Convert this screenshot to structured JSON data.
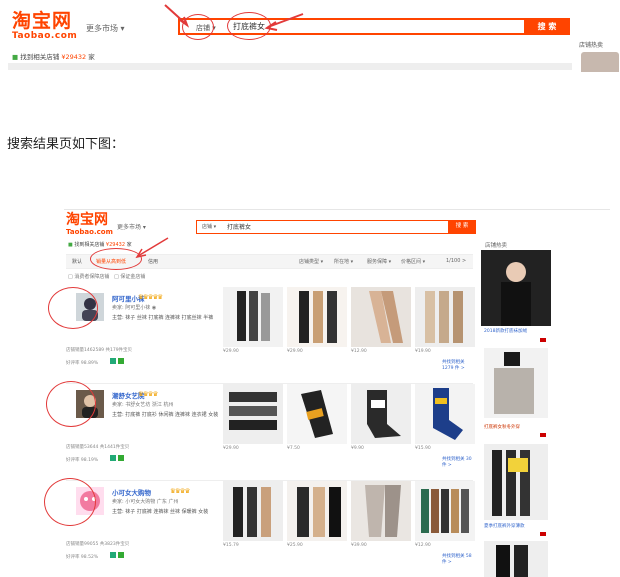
{
  "top_screenshot": {
    "logo_cn": "淘宝网",
    "logo_en": "Taobao.com",
    "market_label": "更多市场 ▾",
    "search_scope": "店铺 ▾",
    "search_query": "打底裤女",
    "search_button": "搜 索",
    "found_text": "找到相关店铺 ",
    "found_count": "¥29432",
    "found_unit": " 家",
    "side_label": "店铺热卖"
  },
  "caption": "搜索结果页如下图：",
  "results_screenshot": {
    "logo_cn": "淘宝网",
    "logo_en": "Taobao.com",
    "market_label": "更多市场 ▾",
    "search_scope": "店铺 ▾",
    "search_query": "打底裤女",
    "search_button": "搜 索",
    "found_text": "找到相关店铺 ",
    "found_count": "¥29432",
    "found_unit": " 家",
    "tabs": [
      "默认",
      "销量从高到低",
      "信用"
    ],
    "filters": [
      "店铺类型 ▾",
      "所在地 ▾",
      "服务保障 ▾",
      "价格区间 ▾",
      "1/100 >"
    ],
    "checks": [
      "□ 消费者保障店铺",
      "□ 保证金店铺"
    ],
    "side_head": "店铺热卖",
    "shops": [
      {
        "name": "阿可里小袜",
        "crowns": "♛♛♛♛♛",
        "line1": "卖家: 阿可里小袜  ◉",
        "line2": "主营: 袜子 丝袜 打底裤 连裤袜 打底丝袜 半裤",
        "stat1": "店铺销量1462589  共179件宝贝",
        "stat2": "好评率 98.89%",
        "prices": [
          "¥29.90",
          "¥29.90",
          "¥12.90",
          "¥19.90"
        ],
        "more": "共找到相关 1279 件 >"
      },
      {
        "name": "潮舒女艺院",
        "crowns": "♛♛♛♛",
        "line1": "卖家: 书舒女艺坊  浙江 杭州",
        "line2": "主营: 打底裤 打底衫 休闲裤 连裤袜 连衣裙 女装",
        "stat1": "店铺销量53644  共1441件宝贝",
        "stat2": "好评率 98.19%",
        "prices": [
          "¥29.90",
          "¥7.50",
          "¥9.90",
          "¥15.90"
        ],
        "more": "共找到相关 30 件 >"
      },
      {
        "name": "小可女大购物",
        "crowns": "♛♛♛♛",
        "line1": "卖家: 小可女大购物  广东 广州",
        "line2": "主营: 袜子 打底裤 连裤袜 丝袜 保暖裤 女装",
        "stat1": "店铺销量99055  共3823件宝贝",
        "stat2": "好评率 98.52%",
        "prices": [
          "¥15.79",
          "¥25.90",
          "¥39.90",
          "¥12.90"
        ],
        "more": "共找到相关 58 件 >"
      }
    ],
    "side_labels": [
      "2018新款打底袜加绒",
      "打底裤女秋冬外穿",
      "夏季打底裤外穿薄款"
    ]
  }
}
